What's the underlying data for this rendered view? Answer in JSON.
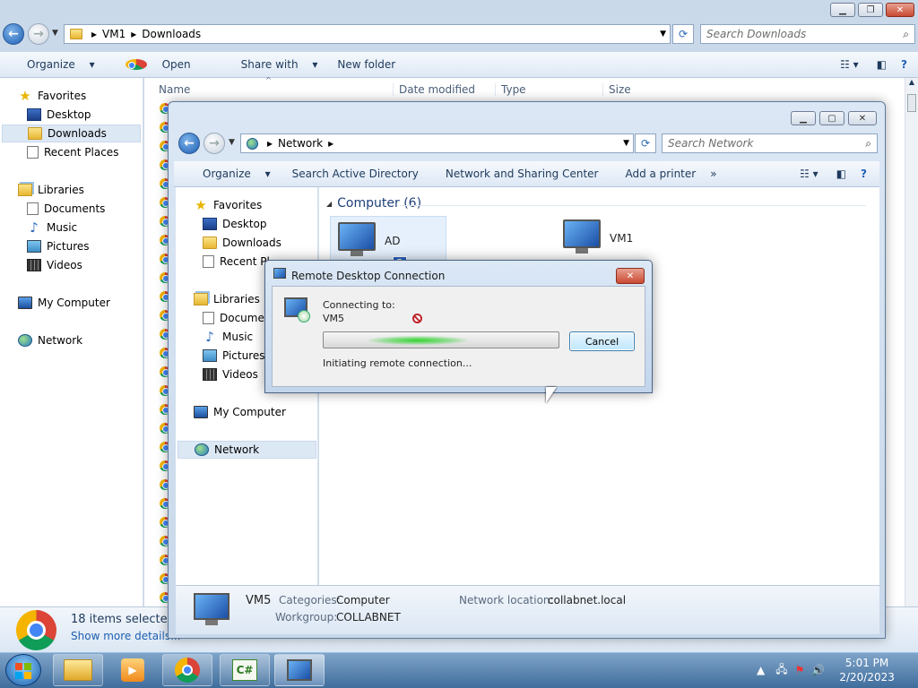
{
  "downloads_window": {
    "breadcrumb": [
      "VM1",
      "Downloads"
    ],
    "search_placeholder": "Search Downloads",
    "toolbar": {
      "organize": "Organize",
      "open": "Open",
      "share_with": "Share with",
      "new_folder": "New folder"
    },
    "columns": [
      "Name",
      "Date modified",
      "Type",
      "Size"
    ],
    "nav": {
      "favorites": "Favorites",
      "desktop": "Desktop",
      "downloads": "Downloads",
      "recent_places": "Recent Places",
      "libraries": "Libraries",
      "documents": "Documents",
      "music": "Music",
      "pictures": "Pictures",
      "videos": "Videos",
      "my_computer": "My Computer",
      "network": "Network"
    },
    "details": {
      "selected": "18 items selected",
      "show_more": "Show more details..."
    }
  },
  "network_window": {
    "breadcrumb": [
      "Network"
    ],
    "search_placeholder": "Search Network",
    "toolbar": {
      "organize": "Organize",
      "search_ad": "Search Active Directory",
      "sharing_center": "Network and Sharing Center",
      "add_printer": "Add a printer",
      "more": "»"
    },
    "nav": {
      "favorites": "Favorites",
      "desktop": "Desktop",
      "downloads": "Downloads",
      "recent_places": "Recent Pl",
      "libraries": "Libraries",
      "documents": "Documen",
      "music": "Music",
      "pictures": "Pictures",
      "videos": "Videos",
      "my_computer": "My Computer",
      "network": "Network"
    },
    "group_header": "Computer (6)",
    "computers": [
      {
        "name": "AD"
      },
      {
        "name": "VM1"
      }
    ],
    "drag_badge": "2",
    "details": {
      "name": "VM5",
      "categories_label": "Categories:",
      "categories": "Computer",
      "workgroup_label": "Workgroup:",
      "workgroup": "COLLABNET",
      "location_label": "Network location:",
      "location": "collabnet.local"
    }
  },
  "rdp_dialog": {
    "title": "Remote Desktop Connection",
    "connecting_label": "Connecting to:",
    "target": "VM5",
    "status": "Initiating remote connection...",
    "cancel": "Cancel"
  },
  "taskbar": {
    "time": "5:01 PM",
    "date": "2/20/2023",
    "apps": [
      "start-orb",
      "windows-explorer",
      "media-player",
      "chrome",
      "csharp-ide",
      "remote-desktop"
    ]
  }
}
